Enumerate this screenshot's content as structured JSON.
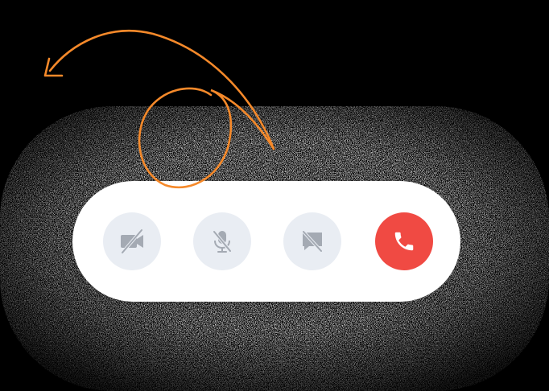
{
  "call_controls": {
    "buttons": [
      {
        "icon": "video-off-icon",
        "active": false,
        "bg": "#e9edf3"
      },
      {
        "icon": "mic-off-icon",
        "active": false,
        "bg": "#e9edf3"
      },
      {
        "icon": "chat-off-icon",
        "active": false,
        "bg": "#e9edf3"
      },
      {
        "icon": "phone-icon",
        "active": true,
        "bg": "#f04a43"
      }
    ]
  },
  "colors": {
    "background": "#000000",
    "bar": "#ffffff",
    "icon_muted": "#a4aab3",
    "end_call": "#f04a43",
    "scribble": "#f5892a"
  }
}
